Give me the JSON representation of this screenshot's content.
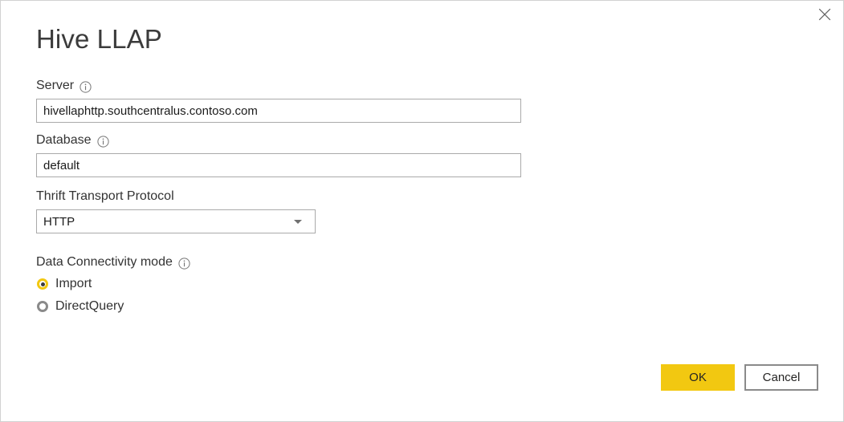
{
  "dialog": {
    "title": "Hive LLAP",
    "close_icon": "close-icon"
  },
  "form": {
    "server": {
      "label": "Server",
      "info_icon": "info-icon",
      "value": "hivellaphttp.southcentralus.contoso.com",
      "placeholder": ""
    },
    "database": {
      "label": "Database",
      "info_icon": "info-icon",
      "value": "default",
      "placeholder": ""
    },
    "thrift_transport_protocol": {
      "label": "Thrift Transport Protocol",
      "selected": "HTTP",
      "options": [
        "HTTP"
      ],
      "arrow_icon": "chevron-down-icon"
    },
    "data_connectivity_mode": {
      "label": "Data Connectivity mode",
      "info_icon": "info-icon",
      "options": [
        {
          "label": "Import",
          "selected": true
        },
        {
          "label": "DirectQuery",
          "selected": false
        }
      ]
    }
  },
  "footer": {
    "ok_label": "OK",
    "cancel_label": "Cancel"
  },
  "colors": {
    "accent_yellow": "#f2c811",
    "title_text": "#3b3b3b",
    "body_text": "#333333",
    "input_border": "#aaaaaa",
    "button_border": "#8a8a8a",
    "dialog_border": "#d2d2d2"
  }
}
